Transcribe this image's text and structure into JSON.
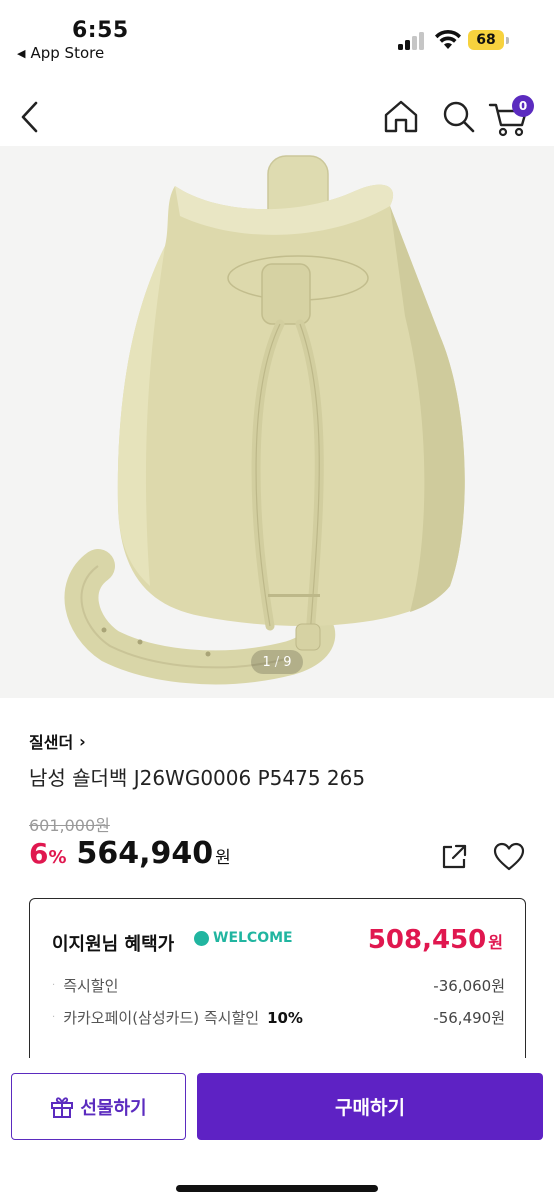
{
  "status_bar": {
    "time": "6:55",
    "back_label": "App Store",
    "battery": "68",
    "battery_color": "#f7d23e"
  },
  "nav": {
    "icons": [
      "back-icon",
      "home-icon",
      "search-icon",
      "cart-icon"
    ],
    "cart_count": "0"
  },
  "image": {
    "current": "1",
    "total": "9"
  },
  "product": {
    "brand": "질샌더",
    "brand_chevron": "›",
    "name": "남성 숄더백 J26WG0006 P5475 265",
    "original_price": "601,000원",
    "discount_value": "6",
    "discount_unit": "%",
    "sale_price": "564,940",
    "currency": "원"
  },
  "benefit": {
    "title": "이지원님 혜택가",
    "badge": "WELCOME",
    "price": "508,450",
    "currency": "원",
    "lines": [
      {
        "label": "즉시할인",
        "highlight": "",
        "amount": "-36,060원"
      },
      {
        "label": "카카오페이(삼성카드) 즉시할인",
        "highlight": "10%",
        "amount": "-56,490원"
      }
    ]
  },
  "bottom": {
    "gift_label": "선물하기",
    "buy_label": "구매하기"
  },
  "colors": {
    "accent": "#5b2bbf",
    "discount": "#e0174f",
    "welcome": "#21b5a0"
  }
}
